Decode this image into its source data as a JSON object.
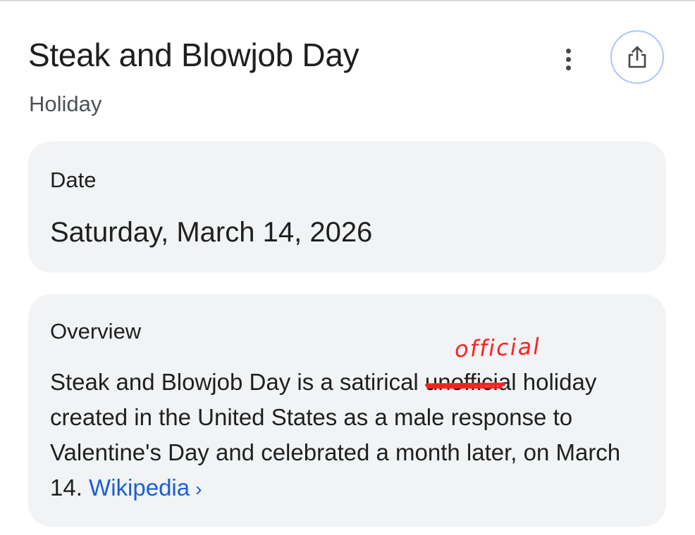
{
  "header": {
    "title": "Steak and Blowjob Day",
    "subtitle": "Holiday"
  },
  "actions": {
    "more_icon": "more-vert-icon",
    "share_icon": "share-icon"
  },
  "date_card": {
    "label": "Date",
    "value": "Saturday, March 14, 2026"
  },
  "overview_card": {
    "label": "Overview",
    "text_before": "Steak and Blowjob Day is a satirical ",
    "struck_word": "unofficial",
    "text_after": " holiday created in the United States as a male response to Valentine's Day and celebrated a month later, on March 14. ",
    "link_label": "Wikipedia",
    "link_chevron": "›",
    "annotation": "official"
  },
  "colors": {
    "link": "#1a5fd6",
    "annotation": "#ff2020",
    "card_background": "#f1f3f4",
    "share_border": "#a9c7fa"
  }
}
